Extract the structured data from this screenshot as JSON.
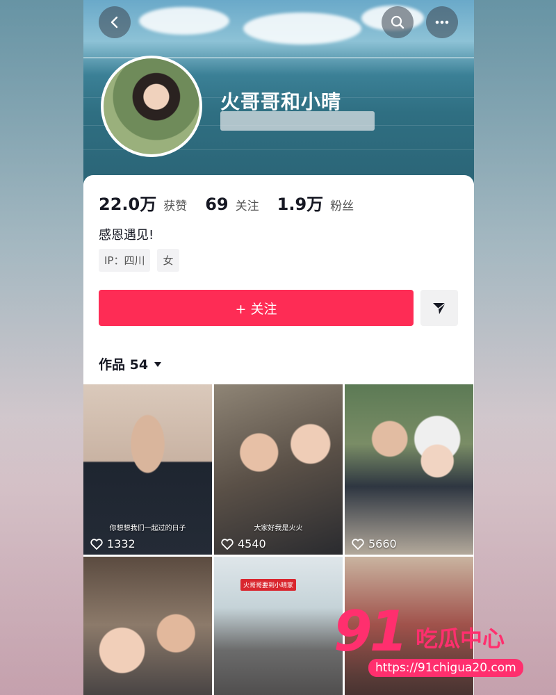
{
  "profile": {
    "name": "火哥哥和小晴",
    "stats": [
      {
        "num": "22.0万",
        "label": "获赞"
      },
      {
        "num": "69",
        "label": "关注"
      },
      {
        "num": "1.9万",
        "label": "粉丝"
      }
    ],
    "bio": "感恩遇见!",
    "tags": [
      "IP：四川",
      "女"
    ],
    "follow_label": "+ 关注",
    "works_label": "作品 54"
  },
  "videos": [
    {
      "likes": "1332",
      "caption": "你想想我们一起过的日子"
    },
    {
      "likes": "4540",
      "caption": "大家好我是火火"
    },
    {
      "likes": "5660",
      "caption": ""
    },
    {
      "likes": "",
      "caption": ""
    },
    {
      "likes": "",
      "caption": "火哥哥要到小晴家"
    },
    {
      "likes": "",
      "caption": ""
    }
  ],
  "watermark": {
    "number": "91",
    "text": "吃瓜中心",
    "url": "https://91chigua20.com"
  },
  "colors": {
    "accent": "#fe2c55",
    "watermark": "#ff2f6e"
  }
}
